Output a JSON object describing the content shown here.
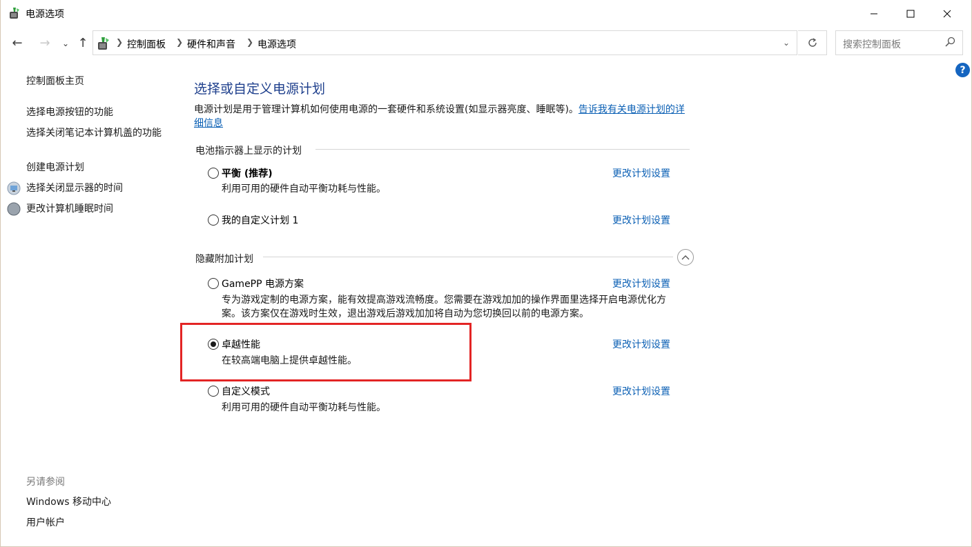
{
  "window": {
    "title": "电源选项",
    "controls": [
      "minimize",
      "maximize",
      "close"
    ]
  },
  "navigation": {
    "breadcrumbs": [
      "控制面板",
      "硬件和声音",
      "电源选项"
    ],
    "search_placeholder": "搜索控制面板"
  },
  "help_label": "?",
  "sidebar": {
    "home": "控制面板主页",
    "links": [
      {
        "label": "选择电源按钮的功能"
      },
      {
        "label": "选择关闭笔记本计算机盖的功能"
      },
      {
        "label": "创建电源计划"
      },
      {
        "label": "选择关闭显示器的时间",
        "icon": "display-icon"
      },
      {
        "label": "更改计算机睡眠时间",
        "icon": "moon-icon"
      }
    ],
    "see_also_title": "另请参阅",
    "see_also": [
      "Windows 移动中心",
      "用户帐户"
    ]
  },
  "main": {
    "title": "选择或自定义电源计划",
    "description": "电源计划是用于管理计算机如何使用电源的一套硬件和系统设置(如显示器亮度、睡眠等)。",
    "description_link": "告诉我有关电源计划的详细信息",
    "battery_group": "电池指示器上显示的计划",
    "hidden_group": "隐藏附加计划",
    "plans": [
      {
        "name": "平衡 (推荐)",
        "description": "利用可用的硬件自动平衡功耗与性能。",
        "link": "更改计划设置",
        "selected": false
      },
      {
        "name": "我的自定义计划 1",
        "description": "",
        "link": "更改计划设置",
        "selected": false
      },
      {
        "name": "GamePP 电源方案",
        "description": "专为游戏定制的电源方案，能有效提高游戏流畅度。您需要在游戏加加的操作界面里选择开启电源优化方案。该方案仅在游戏时生效，退出游戏后游戏加加将自动为您切换回以前的电源方案。",
        "link": "更改计划设置",
        "selected": false
      },
      {
        "name": "卓越性能",
        "description": "在较高端电脑上提供卓越性能。",
        "link": "更改计划设置",
        "selected": true
      },
      {
        "name": "自定义模式",
        "description": "利用可用的硬件自动平衡功耗与性能。",
        "link": "更改计划设置",
        "selected": false
      }
    ]
  },
  "colors": {
    "title_blue": "#1e3f8c",
    "link_blue": "#0a5fb4",
    "highlight_red": "#e32424"
  }
}
